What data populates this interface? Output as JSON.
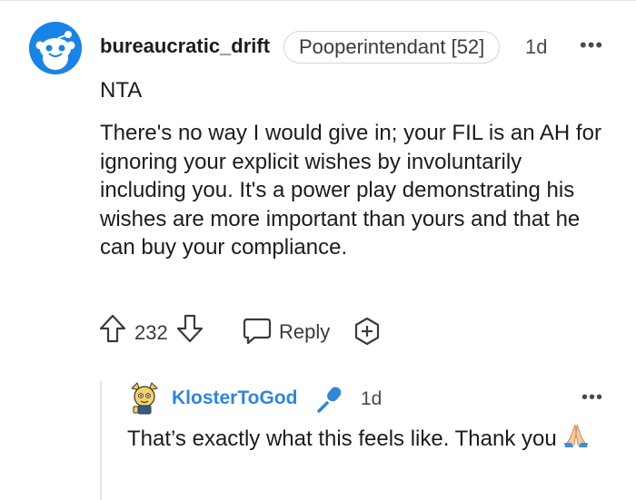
{
  "comment": {
    "username": "bureaucratic_drift",
    "flair": "Pooperintendant [52]",
    "age": "1d",
    "more": "•••",
    "verdict": "NTA",
    "body": "There's no way I would give in; your FIL is an AH for ignoring your explicit wishes by involuntarily including you. It's a power play demonstrating his wishes are more important than yours and that he can buy your compliance.",
    "vote_count": "232",
    "reply_label": "Reply",
    "icons": {
      "upvote": "arrow-up-icon",
      "downvote": "arrow-down-icon",
      "reply": "chat-bubble-icon",
      "award": "award-plus-icon",
      "avatar": "snoo-avatar"
    }
  },
  "reply": {
    "username": "KlosterToGod",
    "age": "1d",
    "more": "•••",
    "body": "That’s exactly what this feels like. Thank you",
    "icons": {
      "badge": "microphone-icon",
      "emoji": "folded-hands-emoji",
      "avatar": "cartoon-avatar"
    }
  },
  "colors": {
    "accent_blue": "#1a83e6",
    "username_blue": "#2f86d6",
    "text": "#1c1c1c"
  }
}
